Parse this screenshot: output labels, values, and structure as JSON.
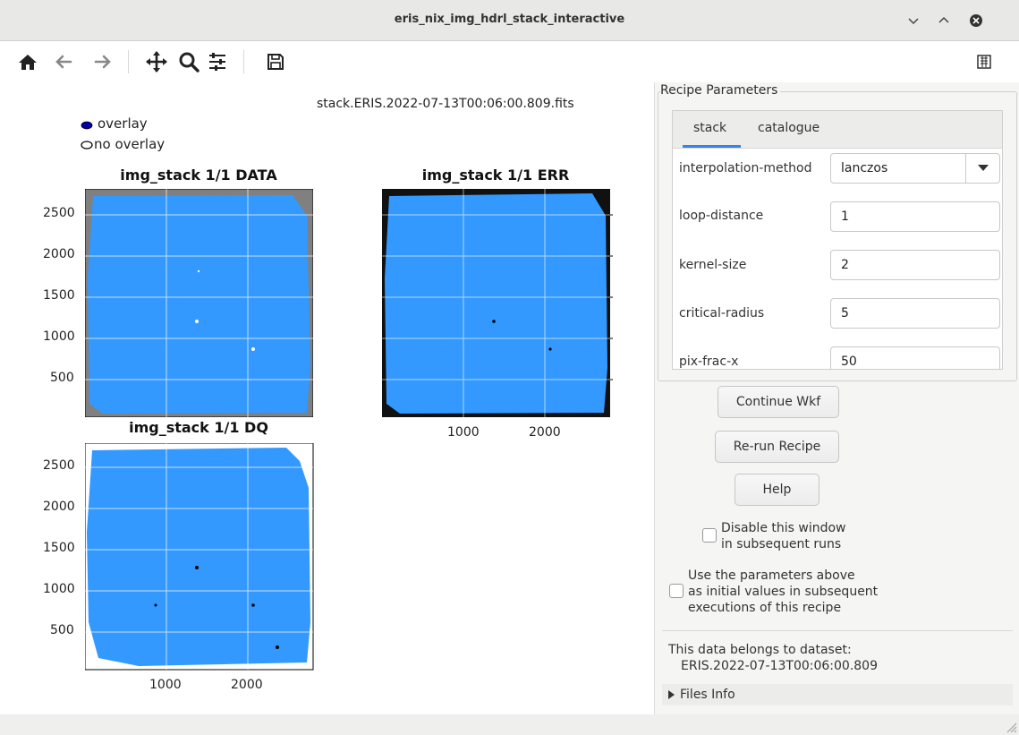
{
  "window": {
    "title": "eris_nix_img_hdrl_stack_interactive"
  },
  "toolbar": {
    "home": "home-icon",
    "back": "back-arrow-icon",
    "forward": "forward-arrow-icon",
    "pan": "pan-icon",
    "zoom": "zoom-icon",
    "configure": "configure-subplots-icon",
    "save": "save-icon",
    "extra": "edit-axis-icon"
  },
  "plot": {
    "filename": "stack.ERIS.2022-07-13T00:06:00.809.fits",
    "legend": [
      {
        "label": "overlay",
        "marker": "filled"
      },
      {
        "label": "no overlay",
        "marker": "open"
      }
    ],
    "panels": [
      {
        "title": "img_stack 1/1 DATA",
        "y_ticks": [
          "2500",
          "2000",
          "1500",
          "1000",
          "500"
        ],
        "background": "#808080"
      },
      {
        "title": "img_stack 1/1 ERR",
        "x_ticks": [
          "1000",
          "2000"
        ],
        "background": "#111111"
      },
      {
        "title": "img_stack 1/1 DQ",
        "y_ticks": [
          "2500",
          "2000",
          "1500",
          "1000",
          "500"
        ],
        "x_ticks": [
          "1000",
          "2000"
        ],
        "background": "#ffffff"
      }
    ],
    "overlay_color": "#3399ff"
  },
  "recipe": {
    "group_title": "Recipe Parameters",
    "tabs": [
      {
        "label": "stack",
        "active": true
      },
      {
        "label": "catalogue",
        "active": false
      }
    ],
    "params": [
      {
        "name": "interpolation-method",
        "value": "lanczos",
        "type": "dropdown"
      },
      {
        "name": "loop-distance",
        "value": "1",
        "type": "text"
      },
      {
        "name": "kernel-size",
        "value": "2",
        "type": "text"
      },
      {
        "name": "critical-radius",
        "value": "5",
        "type": "text"
      },
      {
        "name": "pix-frac-x",
        "value": "50",
        "type": "text"
      }
    ],
    "buttons": {
      "continue": "Continue Wkf",
      "rerun": "Re-run Recipe",
      "help": "Help"
    },
    "checkboxes": {
      "disable_line1": "Disable this window",
      "disable_line2": "in subsequent runs",
      "use_line1": "Use the parameters above",
      "use_line2": "as initial values in subsequent",
      "use_line3": "executions of this recipe"
    },
    "dataset_label": "This data belongs to dataset:",
    "dataset_value": "ERIS.2022-07-13T00:06:00.809",
    "files_info": "Files Info"
  },
  "colors": {
    "accent": "#3584e4"
  }
}
